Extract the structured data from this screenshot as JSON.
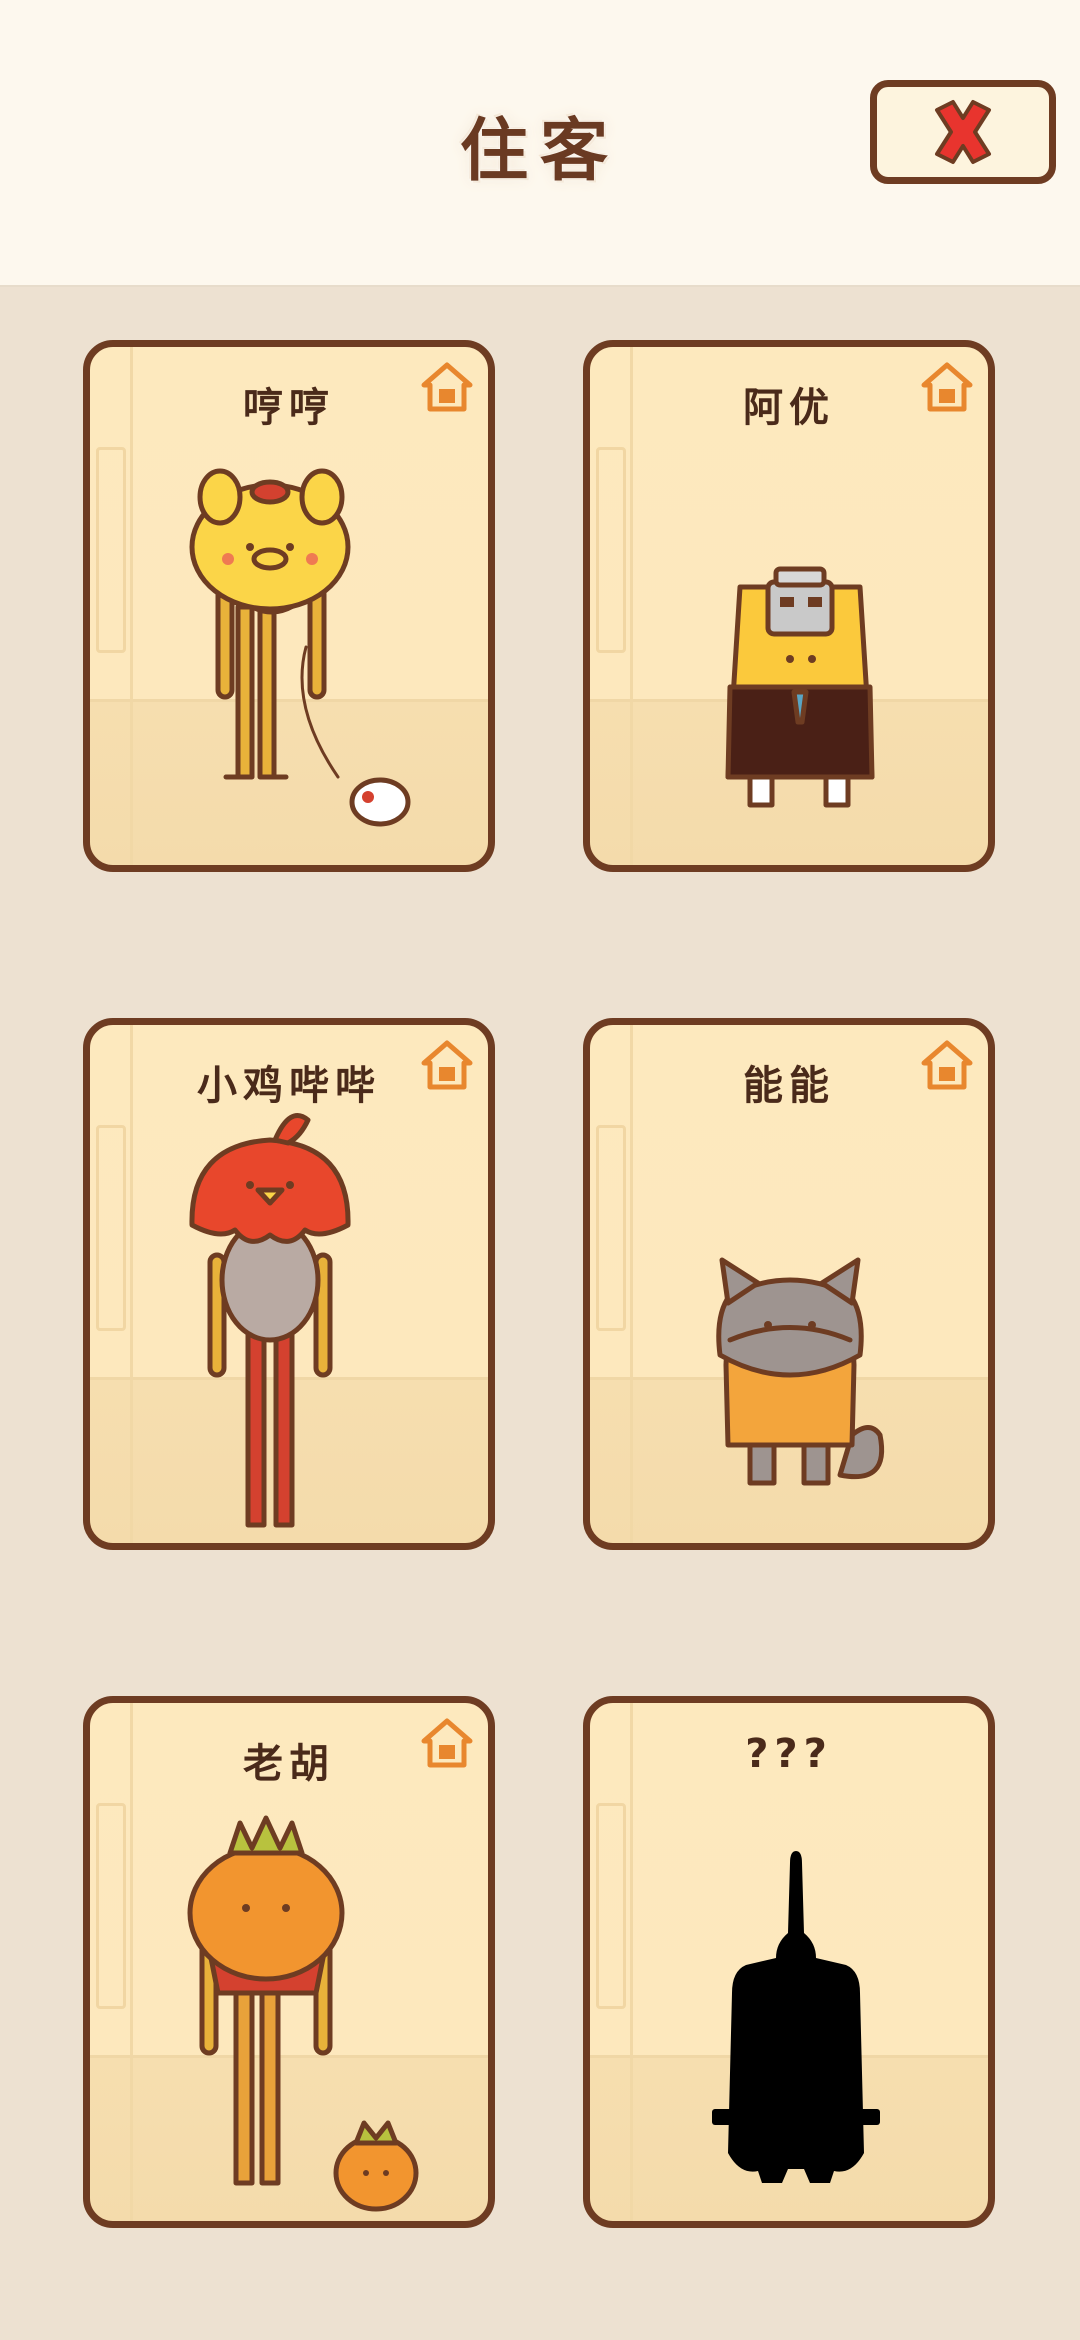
{
  "header": {
    "title": "住客"
  },
  "close_button": {
    "icon": "close-icon"
  },
  "residents": [
    {
      "name": "哼哼",
      "icon": "house-icon"
    },
    {
      "name": "阿优",
      "icon": "house-icon"
    },
    {
      "name": "小鸡哔哔",
      "icon": "house-icon"
    },
    {
      "name": "能能",
      "icon": "house-icon"
    },
    {
      "name": "老胡",
      "icon": "house-icon"
    },
    {
      "name": "???"
    }
  ],
  "colors": {
    "brown": "#6e3c22",
    "card_bg": "#fde9be",
    "accent_orange": "#e8872e",
    "close_red": "#e8342e"
  }
}
